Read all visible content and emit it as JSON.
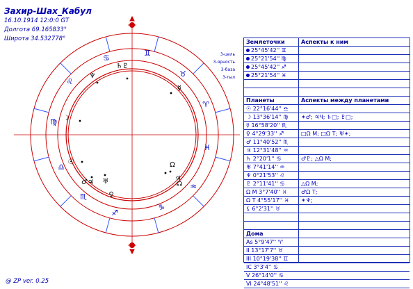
{
  "header": {
    "title": "Захир-Шах_Кабул",
    "datetime": "16.10.1914 12:0:0 GT",
    "longitude": "Долгота 69.165833°",
    "latitude": "Широта 34.532778°"
  },
  "footer": "@ ZP  ver. 0.25",
  "wheel": {
    "signs": [
      "♊",
      "♉",
      "♈",
      "♓",
      "♒",
      "♑",
      "♐",
      "♏",
      "♎",
      "♍",
      "♌",
      "♋"
    ],
    "point_labels": [
      "3-цель",
      "3-ярность",
      "3-база",
      "3-тыл"
    ],
    "planet_glyphs": [
      "♄♇",
      "♆",
      "☽",
      "☉",
      "♂♃",
      "♀",
      "♅",
      "♃",
      "☿",
      "Ω",
      "☊"
    ],
    "colors": {
      "axis": "#cc0000",
      "signs": "#0000c0",
      "ring": "#cc0000"
    }
  },
  "table": {
    "header1": {
      "left": "Землеточки",
      "right": "Аспекты к ним"
    },
    "points": [
      {
        "left": "25°45'42'' ♊",
        "right": ""
      },
      {
        "left": "25°21'54'' ♍",
        "right": ""
      },
      {
        "left": "25°45'42'' ♐",
        "right": ""
      },
      {
        "left": "25°21'54'' ♓",
        "right": ""
      }
    ],
    "header2": {
      "left": "Планеты",
      "right": "Аспекты между планетами"
    },
    "planets": [
      {
        "left": "☉ 22°16'44'' ♎",
        "right": ""
      },
      {
        "left": "☽ 13°36'14'' ♍",
        "right": "✶♂; ♃Ч; ♄□; ♇□;"
      },
      {
        "left": "☿ 16°58'20'' ♏",
        "right": ""
      },
      {
        "left": "♀ 4°29'33'' ♐",
        "right": "□Ω M; □Ω T; ♅✶;"
      },
      {
        "left": "♂ 11°40'52'' ♏",
        "right": ""
      },
      {
        "left": "♃ 12°31'48'' ♒",
        "right": ""
      },
      {
        "left": "♄ 2°20'1'' ♋",
        "right": "♂♇; △Ω M;"
      },
      {
        "left": "♅ 7°41'14'' ♒",
        "right": ""
      },
      {
        "left": "♆ 0°21'53'' ♌",
        "right": ""
      },
      {
        "left": "♇ 2°11'41'' ♋",
        "right": "△Ω M;"
      },
      {
        "left": "Ω M 3°7'40'' ♓",
        "right": "♂Ω T;"
      },
      {
        "left": "Ω T 4°55'17'' ♓",
        "right": "✶♆;"
      },
      {
        "left": "⚸ 6°2'31'' ♉",
        "right": ""
      }
    ],
    "blank_after_planets": "",
    "header3": {
      "left": "Дома",
      "right": ""
    },
    "houses": [
      {
        "left": "As 5°9'47'' ♈",
        "right": ""
      },
      {
        "left": "II 13°17'7'' ♉",
        "right": ""
      },
      {
        "left": "III 10°19'38'' ♊",
        "right": ""
      },
      {
        "left": "IC 3°3'4'' ♋",
        "right": ""
      },
      {
        "left": "V 26°14'0'' ♋",
        "right": ""
      },
      {
        "left": "VI 24°48'51'' ♌",
        "right": ""
      }
    ]
  }
}
